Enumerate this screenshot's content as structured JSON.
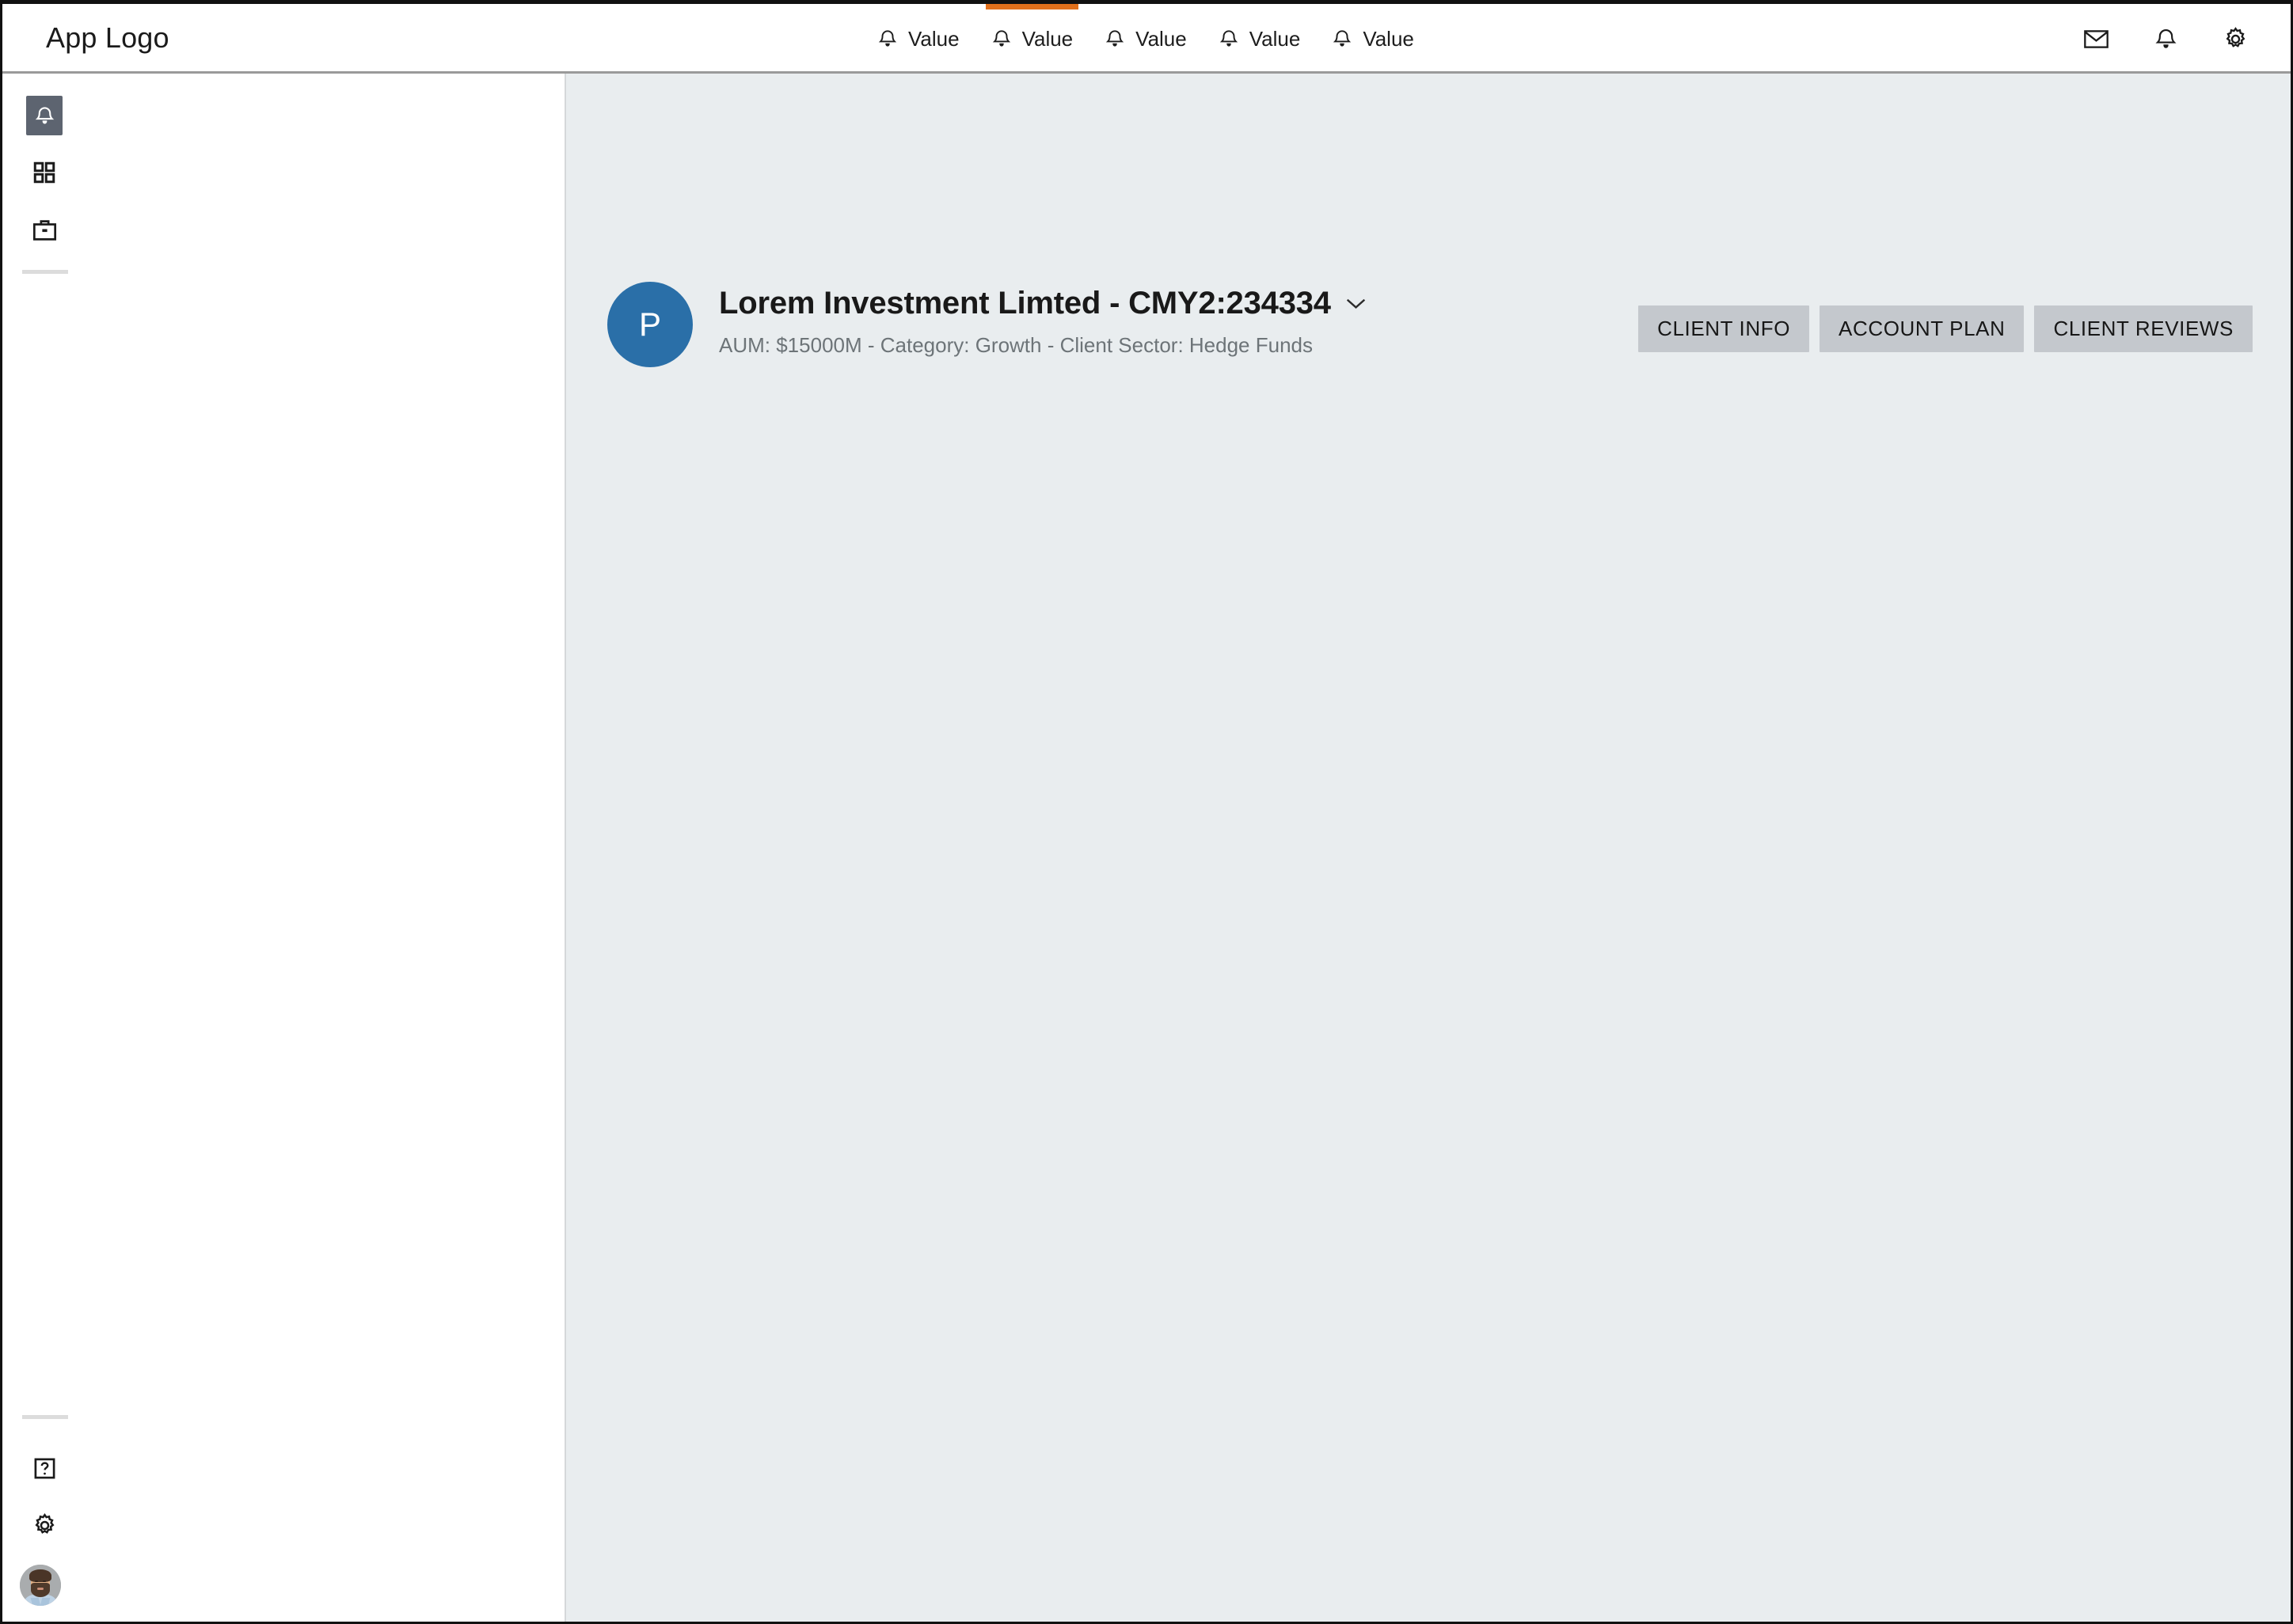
{
  "topbar": {
    "logo": "App Logo",
    "nav_items": [
      {
        "icon": "bell-icon",
        "label": "Value",
        "active": false
      },
      {
        "icon": "bell-icon",
        "label": "Value",
        "active": true
      },
      {
        "icon": "bell-icon",
        "label": "Value",
        "active": false
      },
      {
        "icon": "bell-icon",
        "label": "Value",
        "active": false
      },
      {
        "icon": "bell-icon",
        "label": "Value",
        "active": false
      }
    ],
    "actions": [
      {
        "icon": "mail-icon",
        "name": "messages-button"
      },
      {
        "icon": "bell-icon",
        "name": "notifications-button"
      },
      {
        "icon": "gear-icon",
        "name": "settings-button"
      }
    ],
    "active_indicator_color": "#e2701b",
    "border_color": "#9a9a9a"
  },
  "sidebar": {
    "top_items": [
      {
        "icon": "bell-icon",
        "name": "sidebar-item-alerts",
        "active": true
      },
      {
        "icon": "grid-icon",
        "name": "sidebar-item-apps",
        "active": false
      },
      {
        "icon": "briefcase-icon",
        "name": "sidebar-item-portfolio",
        "active": false
      }
    ],
    "bottom_items": [
      {
        "icon": "help-icon",
        "name": "sidebar-item-help"
      },
      {
        "icon": "gear-icon",
        "name": "sidebar-item-settings"
      }
    ],
    "avatar": {
      "name": "user-avatar",
      "icon": "user-photo"
    },
    "active_tile_color": "#5d6470",
    "divider_color": "#dcdcdc"
  },
  "main": {
    "background_color": "#e9edef",
    "client": {
      "avatar_initial": "P",
      "avatar_color": "#2a6fa8",
      "title": "Lorem Investment Limted - CMY2:234334",
      "subtitle": "AUM: $15000M - Category: Growth - Client Sector: Hedge Funds",
      "dropdown_icon": "chevron-down-icon"
    },
    "actions": [
      {
        "label": "CLIENT INFO",
        "name": "client-info-button"
      },
      {
        "label": "ACCOUNT PLAN",
        "name": "account-plan-button"
      },
      {
        "label": "CLIENT REVIEWS",
        "name": "client-reviews-button"
      }
    ],
    "action_button_color": "#c4c8cd"
  }
}
